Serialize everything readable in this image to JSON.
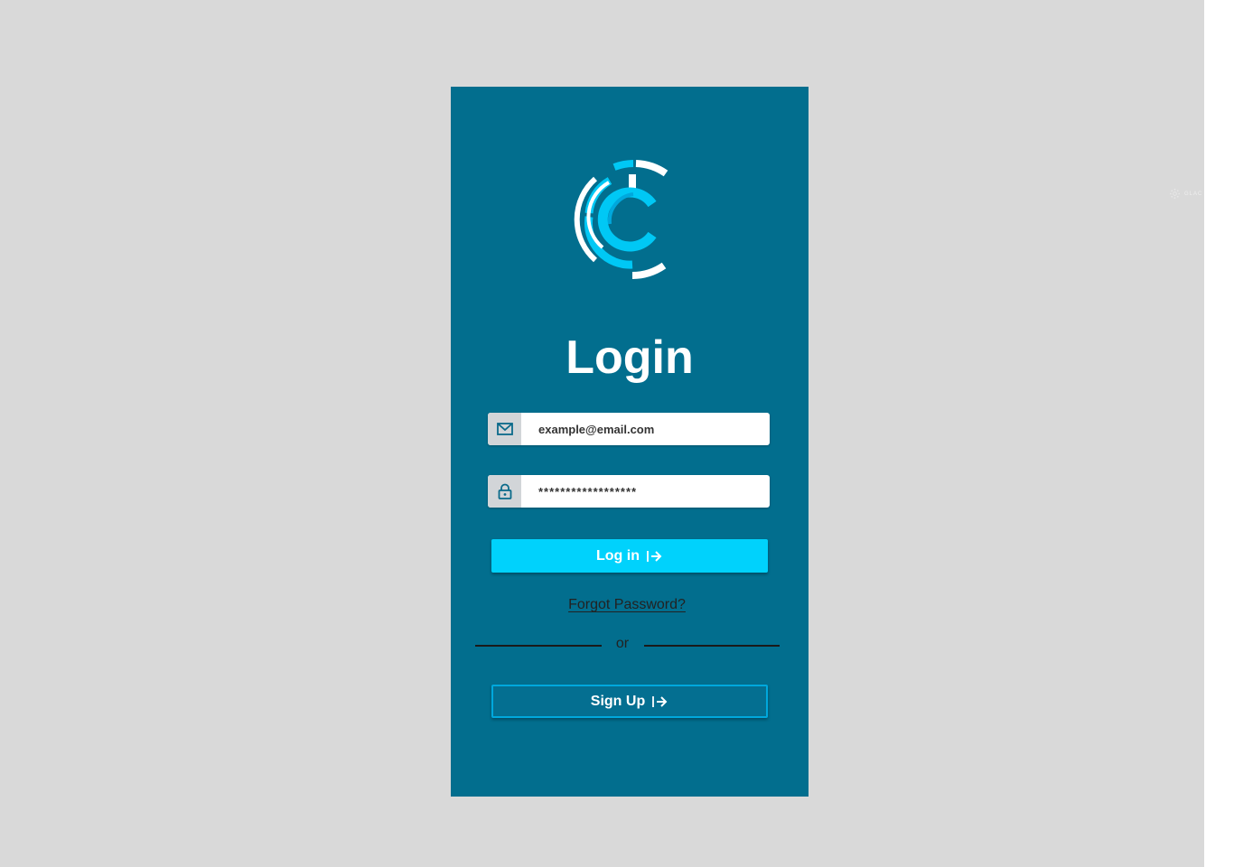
{
  "app": {
    "watermark_text": "GLAC"
  },
  "login": {
    "title": "Login",
    "email_placeholder": "example@email.com",
    "password_value": "******************",
    "login_button_label": "Log in",
    "forgot_password_label": "Forgot Password?",
    "divider_text": "or",
    "signup_button_label": "Sign Up"
  },
  "icons": {
    "email": "envelope-icon",
    "password": "lock-icon",
    "login_arrow": "arrow-right-icon",
    "signup_arrow": "arrow-right-icon",
    "logo": "c-logo"
  },
  "colors": {
    "background": "#d9d9d9",
    "panel": "#026e8e",
    "accent": "#00d2fc",
    "logo_light": "#00c8f5",
    "field_icon_bg": "#d2d5d8"
  }
}
